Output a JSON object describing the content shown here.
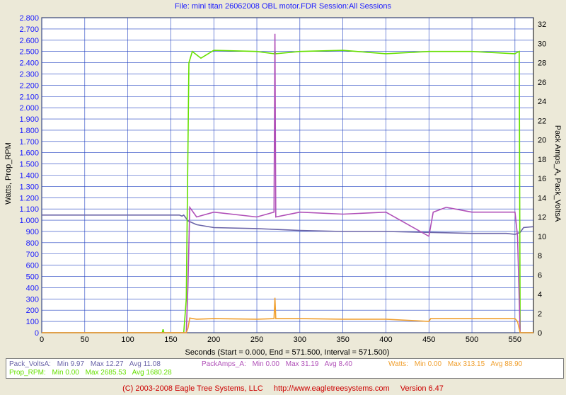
{
  "header": {
    "file_title": "File: mini titan 26062008  OBL motor.FDR   Session:All Sessions"
  },
  "chart_data": {
    "type": "line",
    "xlabel": "Seconds (Start = 0.000,  End = 571.500,  Interval = 571.500)",
    "ylabel_left": "Watts, Prop_RPM",
    "ylabel_right": "Pack Amps_A, Pack_VoltsA",
    "xlim": [
      0,
      571.5
    ],
    "ylim_left": [
      0,
      2800
    ],
    "ylim_right": [
      0,
      32.67
    ],
    "x_ticks": [
      0,
      50,
      100,
      150,
      200,
      250,
      300,
      350,
      400,
      450,
      500,
      550
    ],
    "x_tick_labels": [
      "0",
      "50",
      "100",
      "150",
      "200",
      "250",
      "300",
      "350",
      "400",
      "450",
      "500",
      "550"
    ],
    "y_left_ticks": [
      0,
      100,
      200,
      300,
      400,
      500,
      600,
      700,
      800,
      900,
      1000,
      1100,
      1200,
      1300,
      1400,
      1500,
      1600,
      1700,
      1800,
      1900,
      2000,
      2100,
      2200,
      2300,
      2400,
      2500,
      2600,
      2700,
      2800
    ],
    "y_left_tick_labels": [
      "0",
      "100",
      "200",
      "300",
      "400",
      "500",
      "600",
      "700",
      "800",
      "900",
      "1.000",
      "1.100",
      "1.200",
      "1.300",
      "1.400",
      "1.500",
      "1.600",
      "1.700",
      "1.800",
      "1.900",
      "2.000",
      "2.100",
      "2.200",
      "2.300",
      "2.400",
      "2.500",
      "2.600",
      "2.700",
      "2.800"
    ],
    "y_right_ticks": [
      0,
      2,
      4,
      6,
      8,
      10,
      12,
      14,
      16,
      18,
      20,
      22,
      24,
      26,
      28,
      30,
      32
    ],
    "y_right_tick_labels": [
      "0",
      "2",
      "4",
      "6",
      "8",
      "10",
      "12",
      "14",
      "16",
      "18",
      "20",
      "22",
      "24",
      "26",
      "28",
      "30",
      "32"
    ],
    "grid": true,
    "series": [
      {
        "name": "Pack_VoltsA",
        "axis": "right",
        "color": "#6a64a8",
        "x": [
          0,
          160,
          163,
          165,
          170,
          180,
          200,
          250,
          300,
          350,
          400,
          450,
          500,
          540,
          550,
          556,
          560,
          571.5
        ],
        "y": [
          12.2,
          12.2,
          12.1,
          12.2,
          11.6,
          11.2,
          10.9,
          10.8,
          10.6,
          10.5,
          10.5,
          10.4,
          10.3,
          10.3,
          10.2,
          10.4,
          10.9,
          11.0
        ]
      },
      {
        "name": "Prop_RPM",
        "axis": "left",
        "color": "#66e000",
        "x": [
          0,
          140,
          141,
          142,
          150,
          165,
          168,
          171,
          175,
          185,
          200,
          250,
          270,
          271,
          272,
          300,
          350,
          400,
          450,
          500,
          550,
          552,
          555,
          556,
          571.5
        ],
        "y": [
          0,
          0,
          30,
          0,
          0,
          0,
          300,
          2400,
          2500,
          2440,
          2510,
          2500,
          2480,
          2500,
          2480,
          2500,
          2510,
          2480,
          2500,
          2500,
          2480,
          2490,
          2500,
          0,
          0
        ]
      },
      {
        "name": "PackAmps_A",
        "axis": "right",
        "color": "#b050b8",
        "x": [
          0,
          168,
          170,
          172,
          180,
          200,
          250,
          270,
          271,
          272,
          300,
          350,
          400,
          450,
          455,
          470,
          500,
          550,
          553,
          556,
          571.5
        ],
        "y": [
          0,
          0,
          5,
          13,
          12,
          12.5,
          12,
          12.5,
          31,
          12,
          12.5,
          12.3,
          12.5,
          10,
          12.5,
          13,
          12.5,
          12.5,
          10,
          0,
          0
        ]
      },
      {
        "name": "Watts",
        "axis": "left",
        "color": "#f0a030",
        "x": [
          0,
          168,
          170,
          172,
          180,
          200,
          250,
          270,
          271,
          272,
          300,
          350,
          400,
          450,
          452,
          500,
          550,
          553,
          556,
          571.5
        ],
        "y": [
          0,
          0,
          40,
          130,
          120,
          125,
          120,
          125,
          310,
          125,
          125,
          120,
          120,
          100,
          125,
          125,
          125,
          100,
          0,
          0
        ]
      }
    ]
  },
  "legend": {
    "volts": {
      "name": "Pack_VoltsA:",
      "min": "Min 9.97",
      "max": "Max 12.27",
      "avg": "Avg 11.08",
      "color": "#6a64a8"
    },
    "rpm": {
      "name": "Prop_RPM:",
      "min": "Min 0.00",
      "max": "Max 2685.53",
      "avg": "Avg 1680.28",
      "color": "#66e000"
    },
    "amps": {
      "name": "PackAmps_A:",
      "min": "Min 0.00",
      "max": "Max 31.19",
      "avg": "Avg 8.40",
      "color": "#b050b8"
    },
    "watts": {
      "name": "Watts:",
      "min": "Min 0.00",
      "max": "Max 313.15",
      "avg": "Avg 88.90",
      "color": "#f0a030"
    }
  },
  "footer": {
    "copyright": "(C) 2003-2008 Eagle Tree Systems, LLC",
    "url": "http://www.eagletreesystems.com",
    "version": "Version 6.47"
  }
}
